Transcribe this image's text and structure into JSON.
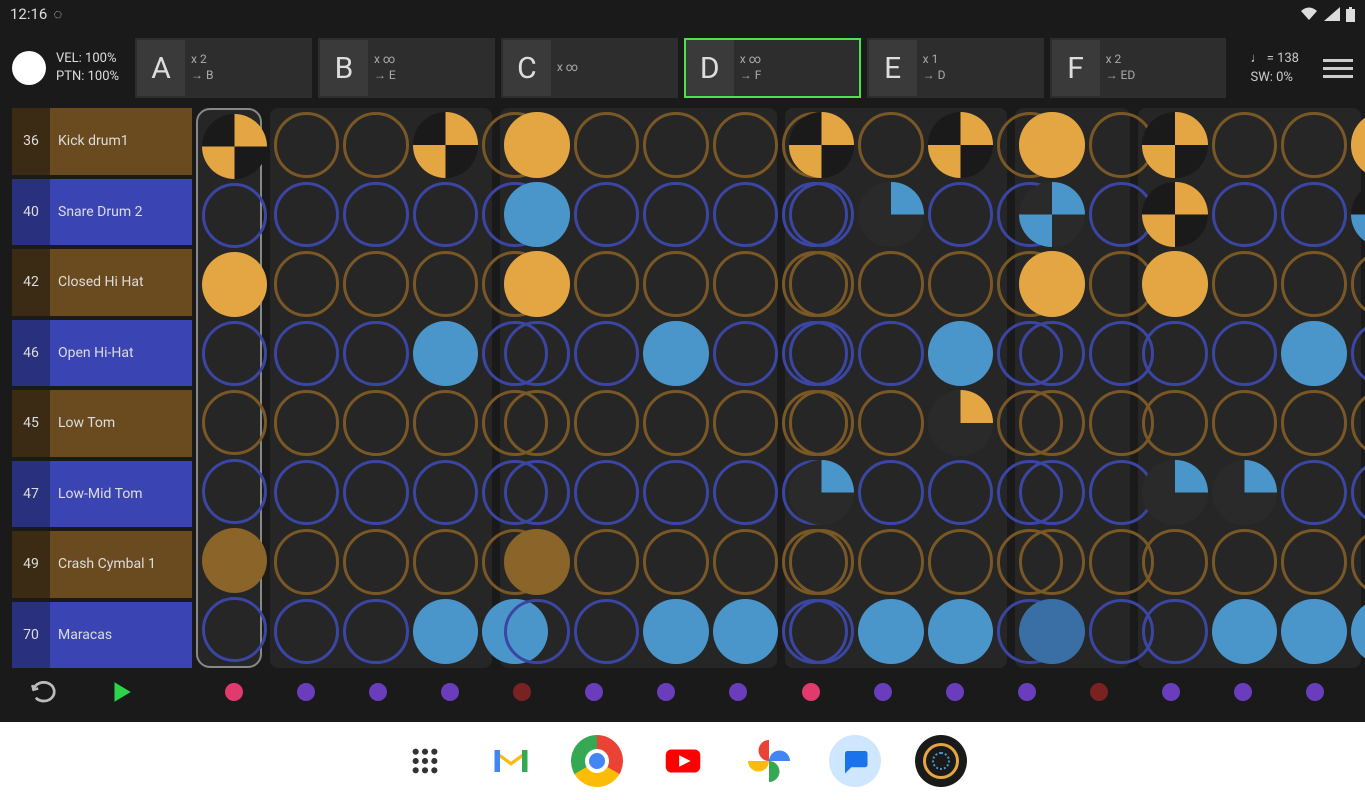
{
  "status": {
    "time": "12:16"
  },
  "meter": {
    "vel": "VEL: 100%",
    "ptn": "PTN: 100%"
  },
  "patterns": [
    {
      "letter": "A",
      "repeat": "x 2",
      "goto": "→ B",
      "active": false
    },
    {
      "letter": "B",
      "repeat": "x ∞",
      "goto": "→ E",
      "active": false
    },
    {
      "letter": "C",
      "repeat": "x ∞",
      "goto": "",
      "active": false
    },
    {
      "letter": "D",
      "repeat": "x ∞",
      "goto": "→ F",
      "active": true
    },
    {
      "letter": "E",
      "repeat": "x 1",
      "goto": "→ D",
      "active": false
    },
    {
      "letter": "F",
      "repeat": "x 2",
      "goto": "→ ED",
      "active": false
    }
  ],
  "tempo": {
    "bpm": "♩ = 138",
    "swing": "SW: 0%"
  },
  "tracks": [
    {
      "num": "36",
      "name": "Kick drum1",
      "color_a": "#3b2a14",
      "color_b": "#6a4a1f",
      "ring": "#7a5825"
    },
    {
      "num": "40",
      "name": "Snare Drum 2",
      "color_a": "#29307d",
      "color_b": "#3a44b3",
      "ring": "#3b46a3"
    },
    {
      "num": "42",
      "name": "Closed Hi Hat",
      "color_a": "#3b2a14",
      "color_b": "#6a4a1f",
      "ring": "#7a5825"
    },
    {
      "num": "46",
      "name": "Open Hi-Hat",
      "color_a": "#29307d",
      "color_b": "#3a44b3",
      "ring": "#3b46a3"
    },
    {
      "num": "45",
      "name": "Low Tom",
      "color_a": "#3b2a14",
      "color_b": "#6a4a1f",
      "ring": "#7a5825"
    },
    {
      "num": "47",
      "name": "Low-Mid Tom",
      "color_a": "#29307d",
      "color_b": "#3a44b3",
      "ring": "#3b46a3"
    },
    {
      "num": "49",
      "name": "Crash Cymbal 1",
      "color_a": "#3b2a14",
      "color_b": "#6a4a1f",
      "ring": "#7a5825"
    },
    {
      "num": "70",
      "name": "Maracas",
      "color_a": "#29307d",
      "color_b": "#3a44b3",
      "ring": "#3b46a3"
    }
  ],
  "colors": {
    "hit_orange": "#e3a642",
    "hit_blue": "#4a96cb",
    "hit_blue_dark": "#3a6fa5",
    "hit_brown": "#8a6428"
  },
  "grid": [
    [
      "q4",
      "",
      "",
      "q4",
      "",
      "f",
      "",
      "",
      "",
      "",
      "q4",
      "",
      "q4",
      "",
      "f",
      "",
      "q4",
      "",
      "",
      "f"
    ],
    [
      "",
      "",
      "",
      "",
      "",
      "f",
      "",
      "",
      "",
      "",
      "",
      "q1",
      "",
      "",
      "q2",
      "",
      "q4",
      "",
      "",
      "q4b"
    ],
    [
      "f",
      "",
      "",
      "",
      "",
      "f",
      "",
      "",
      "",
      "",
      "",
      "",
      "",
      "",
      "f",
      "",
      "f",
      "",
      "",
      ""
    ],
    [
      "",
      "",
      "",
      "f",
      "",
      "",
      "",
      "f",
      "",
      "",
      "",
      "",
      "f",
      "",
      "",
      "",
      "",
      "",
      "f",
      ""
    ],
    [
      "",
      "",
      "",
      "",
      "",
      "",
      "",
      "",
      "",
      "",
      "",
      "",
      "q1",
      "",
      "",
      "",
      "",
      "",
      "",
      ""
    ],
    [
      "",
      "",
      "",
      "",
      "",
      "",
      "",
      "",
      "",
      "",
      "q1",
      "",
      "",
      "",
      "",
      "",
      "q1",
      "q1",
      "",
      ""
    ],
    [
      "fd",
      "",
      "",
      "",
      "",
      "fd",
      "",
      "",
      "",
      "",
      "",
      "",
      "",
      "",
      "",
      "",
      "",
      "",
      "",
      ""
    ],
    [
      "",
      "",
      "",
      "f",
      "f",
      "",
      "",
      "f",
      "f",
      "",
      "",
      "f",
      "f",
      "",
      "fd",
      "",
      "",
      "f",
      "f",
      "f"
    ]
  ],
  "group_sizes": [
    1,
    4,
    5,
    4,
    2,
    4
  ],
  "step_dots": [
    "#e23a6d",
    "#6a3dbd",
    "#6a3dbd",
    "#6a3dbd",
    "#7a2222",
    "#6a3dbd",
    "#6a3dbd",
    "#6a3dbd",
    "#e23a6d",
    "#6a3dbd",
    "#6a3dbd",
    "#6a3dbd",
    "#7a2222",
    "#6a3dbd",
    "#6a3dbd",
    "#6a3dbd"
  ],
  "dock": [
    {
      "name": "apps"
    },
    {
      "name": "gmail"
    },
    {
      "name": "chrome"
    },
    {
      "name": "youtube"
    },
    {
      "name": "photos"
    },
    {
      "name": "messages"
    },
    {
      "name": "drum-app"
    }
  ]
}
